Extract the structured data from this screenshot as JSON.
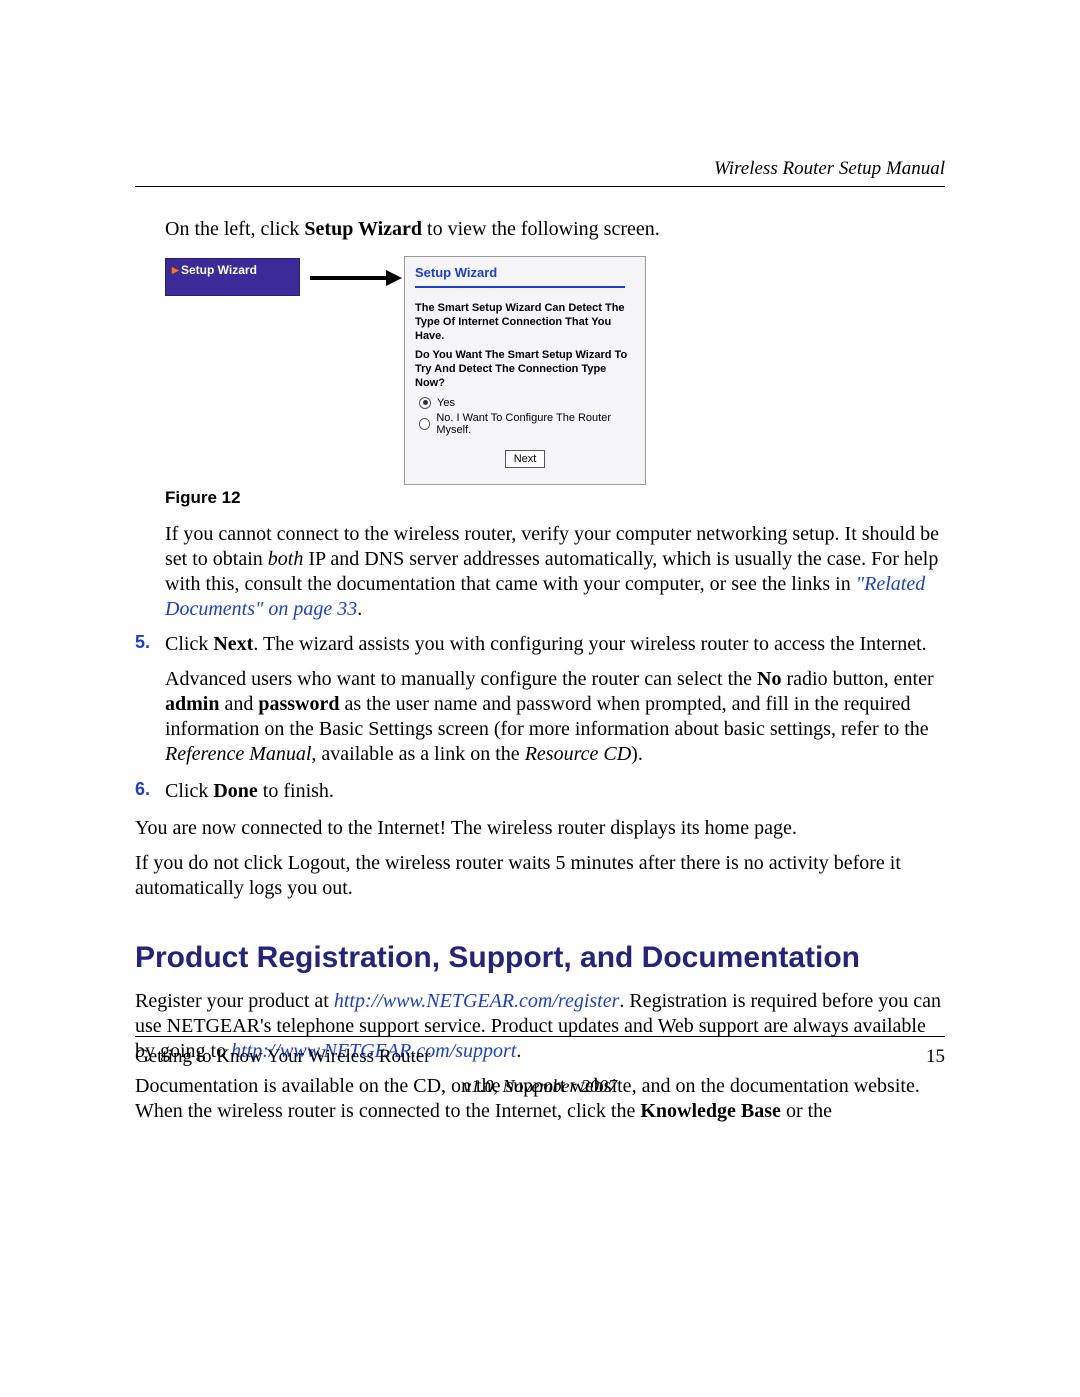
{
  "header": {
    "running_head": "Wireless Router Setup Manual"
  },
  "intro": {
    "pre": "On the left, click ",
    "bold": "Setup Wizard",
    "post": " to view the following screen."
  },
  "figure": {
    "nav_label": "Setup Wizard",
    "panel_title": "Setup Wizard",
    "line1": "The Smart Setup Wizard Can Detect The Type Of Internet Connection That You Have.",
    "line2": "Do You Want The Smart Setup Wizard To Try And Detect The Connection Type Now?",
    "opt_yes": "Yes",
    "opt_no": "No. I Want To Configure The Router Myself.",
    "next_label": "Next",
    "caption": "Figure 12"
  },
  "p_cannot_connect": {
    "t1": "If you cannot connect to the wireless router, verify your computer networking setup. It should be set to obtain ",
    "i1": "both",
    "t2": " IP and DNS server addresses automatically, which is usually the case. For help with this, consult the documentation that came with your computer, or see the links in ",
    "link": "\"Related Documents\" on page 33",
    "t3": "."
  },
  "steps": {
    "s5": {
      "num": "5.",
      "a": "Click ",
      "b": "Next",
      "c": ". The wizard assists you with configuring your wireless router to access the Internet."
    },
    "s5b": {
      "a": "Advanced users who want to manually configure the router can select the ",
      "b": "No",
      "c": " radio button, enter ",
      "d": "admin",
      "e": " and ",
      "f": "password",
      "g": " as the user name and password when prompted, and fill in the required information on the Basic Settings screen (for more information about basic settings, refer to the ",
      "h": "Reference Manual",
      "i": ", available as a link on the ",
      "j": "Resource CD",
      "k": ")."
    },
    "s6": {
      "num": "6.",
      "a": "Click ",
      "b": "Done",
      "c": " to finish."
    }
  },
  "p_connected": "You are now connected to the Internet! The wireless router displays its home page.",
  "p_logout": "If you do not click Logout, the wireless router waits 5 minutes after there is no activity before it automatically logs you out.",
  "section_heading": "Product Registration, Support, and Documentation",
  "p_reg": {
    "a": "Register your product at ",
    "l1": "http://www.NETGEAR.com/register",
    "b": ". Registration is required before you can use NETGEAR's telephone support service. Product updates and Web support are always available by going to ",
    "l2": "http://www.NETGEAR.com/support",
    "c": "."
  },
  "p_doc": {
    "a": "Documentation is available on the CD, on the support website, and on the documentation website. When the wireless router is connected to the Internet, click the ",
    "b": "Knowledge Base",
    "c": " or the"
  },
  "footer": {
    "left": "Getting to Know Your Wireless Router",
    "right": "15",
    "center": "v1.0, November 2007"
  }
}
